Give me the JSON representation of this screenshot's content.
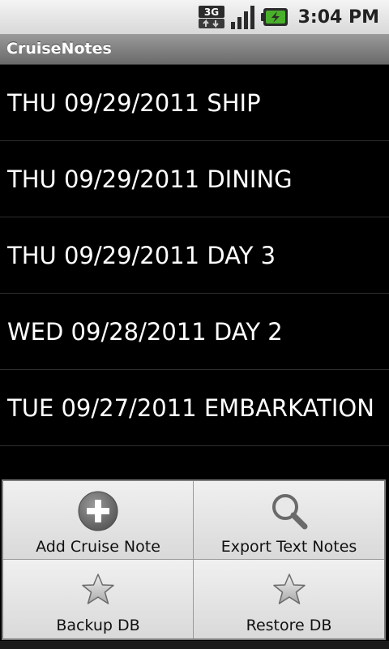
{
  "status_bar": {
    "network_type": "3G",
    "network_icon": "3g-data-icon",
    "signal_icon": "signal-strength-icon",
    "battery_icon": "battery-charging-icon",
    "time": "3:04 PM"
  },
  "app": {
    "title": "CruiseNotes"
  },
  "notes": [
    {
      "label": "THU 09/29/2011 SHIP"
    },
    {
      "label": "THU 09/29/2011 DINING"
    },
    {
      "label": "THU 09/29/2011 DAY 3"
    },
    {
      "label": "WED 09/28/2011 DAY 2"
    },
    {
      "label": "TUE 09/27/2011 EMBARKATION"
    }
  ],
  "menu": {
    "items": [
      {
        "label": "Add Cruise Note",
        "icon": "add-circle-icon"
      },
      {
        "label": "Export Text Notes",
        "icon": "search-icon"
      },
      {
        "label": "Backup DB",
        "icon": "star-icon"
      },
      {
        "label": "Restore DB",
        "icon": "star-icon"
      }
    ]
  },
  "colors": {
    "background": "#000000",
    "text": "#ffffff",
    "battery_accent": "#49b02a"
  }
}
